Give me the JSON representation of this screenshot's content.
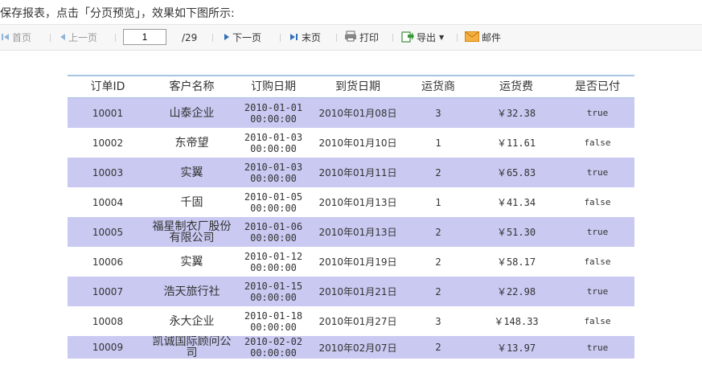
{
  "caption": "保存报表，点击「分页预览」，效果如下图所示:",
  "toolbar": {
    "first_label": "首页",
    "prev_label": "上一页",
    "page_value": "1",
    "page_total": "/29",
    "next_label": "下一页",
    "last_label": "末页",
    "print_label": "打印",
    "export_label": "导出",
    "mail_label": "邮件"
  },
  "table": {
    "headers": [
      "订单ID",
      "客户名称",
      "订购日期",
      "到货日期",
      "运货商",
      "运货费",
      "是否已付"
    ],
    "rows": [
      {
        "id": "10001",
        "customer": "山泰企业",
        "order_date": "2010-01-01",
        "order_time": "00:00:00",
        "arrival": "2010年01月08日",
        "shipper": "3",
        "fee": "￥32.38",
        "paid": "true"
      },
      {
        "id": "10002",
        "customer": "东帝望",
        "order_date": "2010-01-03",
        "order_time": "00:00:00",
        "arrival": "2010年01月10日",
        "shipper": "1",
        "fee": "￥11.61",
        "paid": "false"
      },
      {
        "id": "10003",
        "customer": "实翼",
        "order_date": "2010-01-03",
        "order_time": "00:00:00",
        "arrival": "2010年01月11日",
        "shipper": "2",
        "fee": "￥65.83",
        "paid": "true"
      },
      {
        "id": "10004",
        "customer": "千固",
        "order_date": "2010-01-05",
        "order_time": "00:00:00",
        "arrival": "2010年01月13日",
        "shipper": "1",
        "fee": "￥41.34",
        "paid": "false"
      },
      {
        "id": "10005",
        "customer": "福星制衣厂股份有限公司",
        "order_date": "2010-01-06",
        "order_time": "00:00:00",
        "arrival": "2010年01月13日",
        "shipper": "2",
        "fee": "￥51.30",
        "paid": "true"
      },
      {
        "id": "10006",
        "customer": "实翼",
        "order_date": "2010-01-12",
        "order_time": "00:00:00",
        "arrival": "2010年01月19日",
        "shipper": "2",
        "fee": "￥58.17",
        "paid": "false"
      },
      {
        "id": "10007",
        "customer": "浩天旅行社",
        "order_date": "2010-01-15",
        "order_time": "00:00:00",
        "arrival": "2010年01月21日",
        "shipper": "2",
        "fee": "￥22.98",
        "paid": "true"
      },
      {
        "id": "10008",
        "customer": "永大企业",
        "order_date": "2010-01-18",
        "order_time": "00:00:00",
        "arrival": "2010年01月27日",
        "shipper": "3",
        "fee": "￥148.33",
        "paid": "false"
      },
      {
        "id": "10009",
        "customer": "凯诚国际顾问公司",
        "order_date": "2010-02-02",
        "order_time": "00:00:00",
        "arrival": "2010年02月07日",
        "shipper": "2",
        "fee": "￥13.97",
        "paid": "true"
      }
    ]
  }
}
